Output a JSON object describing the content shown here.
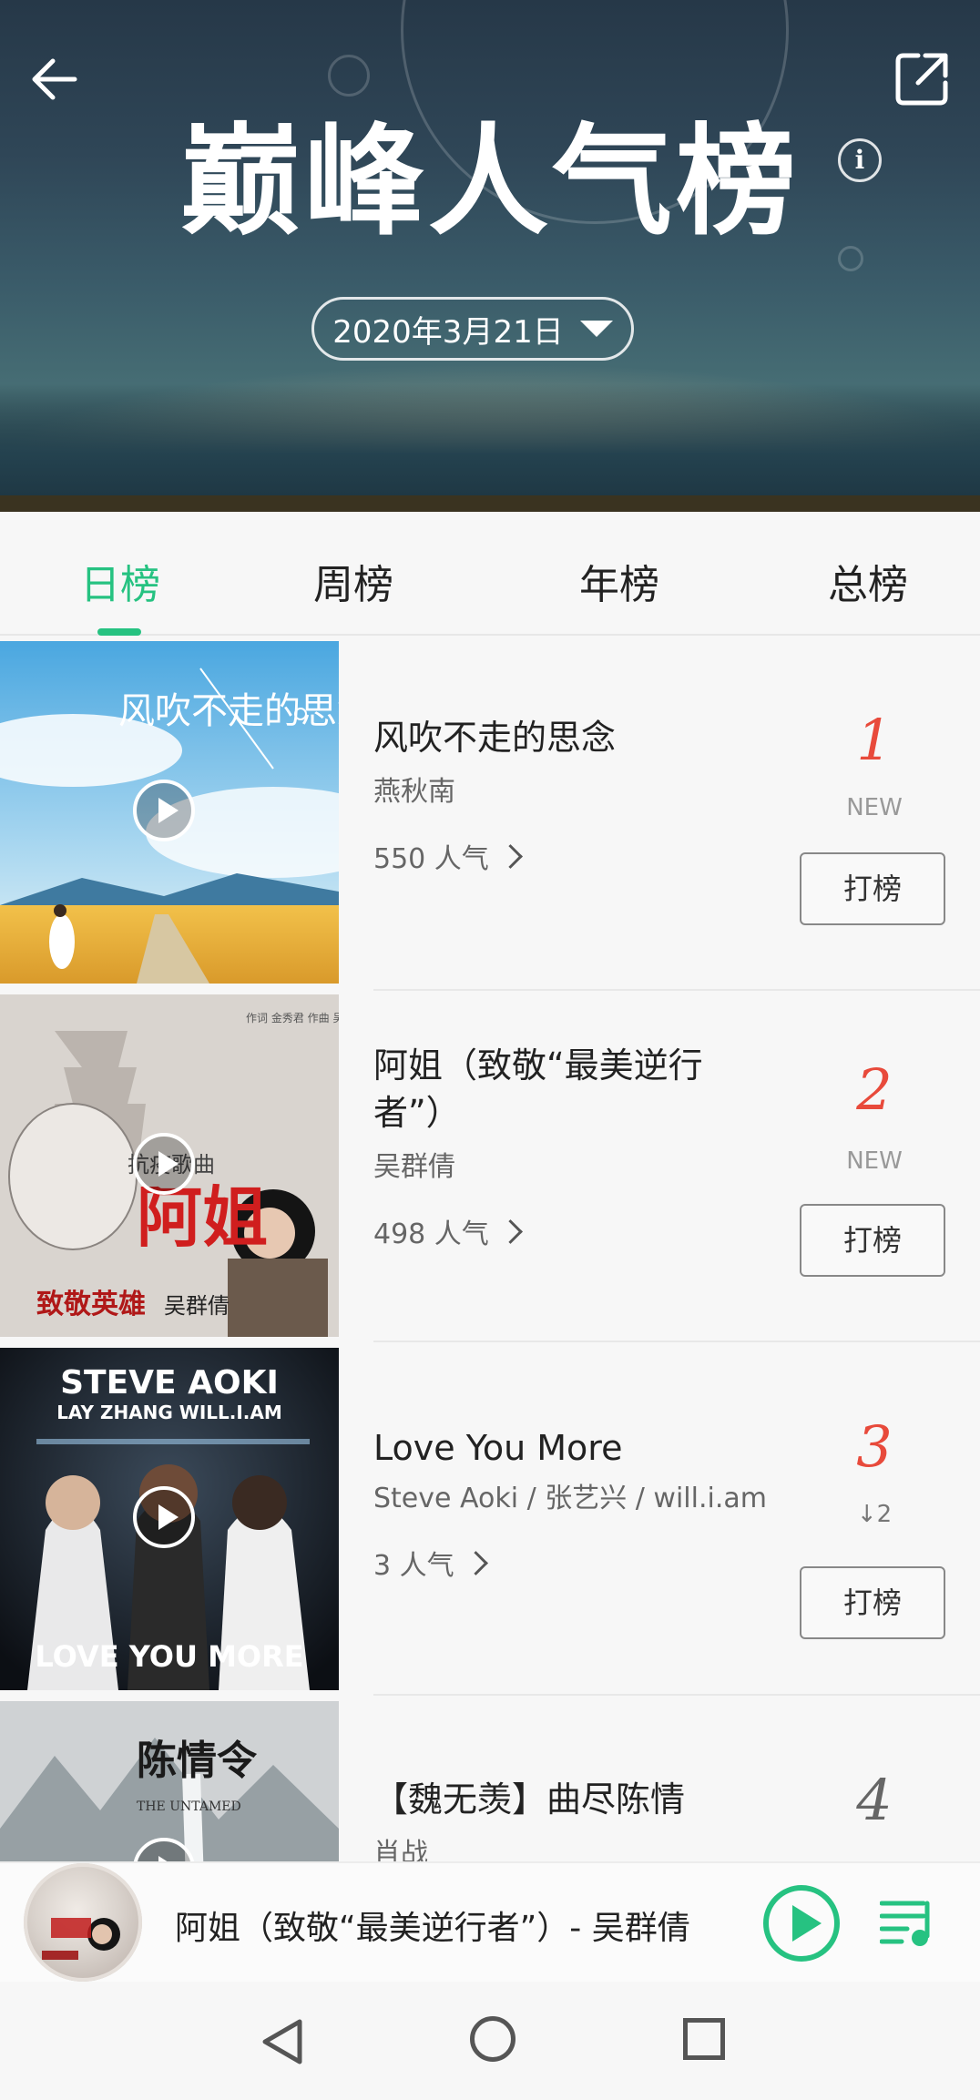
{
  "header": {
    "title": "巅峰人气榜",
    "date": "2020年3月21日"
  },
  "tabs": [
    {
      "label": "日榜",
      "active": true
    },
    {
      "label": "周榜",
      "active": false
    },
    {
      "label": "年榜",
      "active": false
    },
    {
      "label": "总榜",
      "active": false
    }
  ],
  "songs": [
    {
      "title": "风吹不走的思念",
      "artist": "燕秋南",
      "popularity": "550 人气",
      "rank": "1",
      "rank_change": "NEW",
      "vote_label": "打榜"
    },
    {
      "title": "阿姐（致敬“最美逆行者”）",
      "artist": "吴群倩",
      "popularity": "498 人气",
      "rank": "2",
      "rank_change": "NEW",
      "vote_label": "打榜"
    },
    {
      "title": "Love You More",
      "artist": "Steve Aoki / 张艺兴 / will.i.am",
      "popularity": "3 人气",
      "rank": "3",
      "rank_change": "↓2",
      "vote_label": "打榜"
    },
    {
      "title": "【魏无羡】曲尽陈情",
      "artist": "肖战",
      "rank": "4"
    }
  ],
  "thumbnails": {
    "song1": {
      "text": "风吹不走的思念"
    },
    "song2": {
      "credits": "作词 金秀君  作曲 吴群倩",
      "subtitle": "抗疫歌曲",
      "title": "阿姐",
      "corner": "致敬英雄",
      "singer": "吴群倩"
    },
    "song3": {
      "artist_line1": "STEVE AOKI",
      "artist_line2": "LAY ZHANG   WILL.I.AM",
      "title": "LOVE YOU MORE"
    },
    "song4": {
      "title": "陈情令",
      "subtitle": "THE UNTAMED"
    }
  },
  "player": {
    "now_playing": "阿姐（致敬“最美逆行者”）- 吴群倩"
  },
  "colors": {
    "accent": "#26c281",
    "rank_red": "#e84a3b"
  }
}
